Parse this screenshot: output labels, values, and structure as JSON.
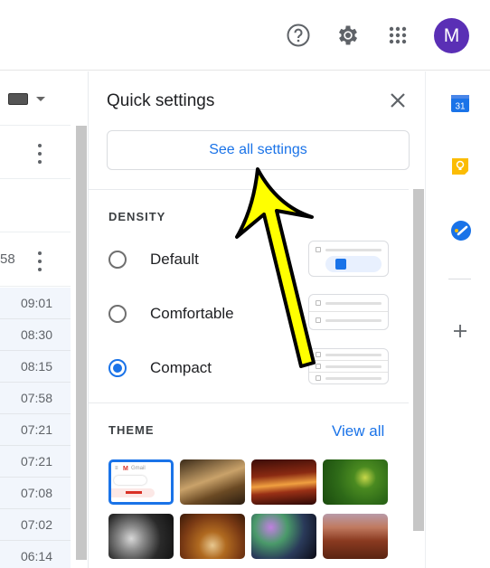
{
  "header": {
    "avatar_initial": "M",
    "avatar_color": "#5a2fb5",
    "icons": [
      "help-icon",
      "settings-gear-icon",
      "apps-grid-icon"
    ]
  },
  "mail_list": {
    "partial_time": "58",
    "times": [
      "09:01",
      "08:30",
      "08:15",
      "07:58",
      "07:21",
      "07:21",
      "07:08",
      "07:02",
      "06:14"
    ]
  },
  "quick_settings": {
    "title": "Quick settings",
    "see_all_label": "See all settings",
    "density": {
      "label": "DENSITY",
      "options": [
        {
          "label": "Default",
          "selected": false
        },
        {
          "label": "Comfortable",
          "selected": false
        },
        {
          "label": "Compact",
          "selected": true
        }
      ]
    },
    "theme": {
      "label": "THEME",
      "view_all_label": "View all",
      "default_preview_text": "Gmail",
      "thumbnails": [
        "default-gmail",
        "chess",
        "canyon",
        "caterpillar",
        "pipes",
        "autumn-leaves",
        "bokeh-lights",
        "river-canyon"
      ]
    }
  },
  "side_panel": {
    "calendar_day": "31",
    "apps": [
      "calendar",
      "keep",
      "tasks"
    ],
    "add_label": "+"
  },
  "colors": {
    "accent": "#1a73e8",
    "arrow": "#ffff00"
  }
}
